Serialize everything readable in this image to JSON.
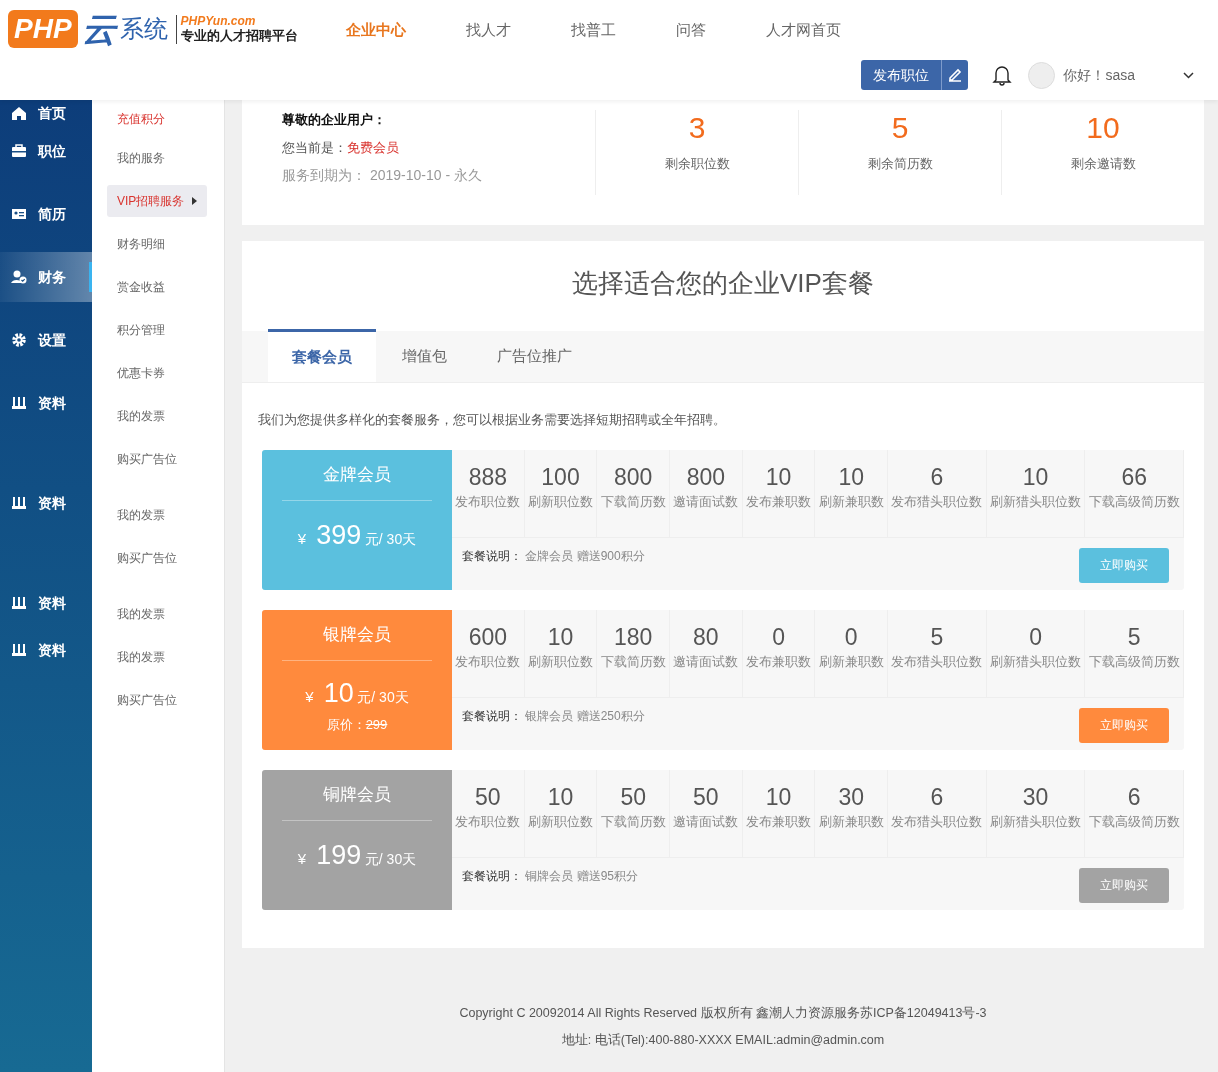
{
  "header": {
    "logo_mark": "PHP",
    "logo_cloud": "云",
    "logo_system": "系统",
    "logo_domain": "PHPYun.com",
    "logo_tagline": "专业的人才招聘平台",
    "nav": [
      {
        "label": "企业中心",
        "selected": true
      },
      {
        "label": "找人才",
        "selected": false
      },
      {
        "label": "找普工",
        "selected": false
      },
      {
        "label": "问答",
        "selected": false
      },
      {
        "label": "人才网首页",
        "selected": false
      }
    ],
    "post_button": "发布职位",
    "greeting": "你好！sasa"
  },
  "sidebar": {
    "items": [
      {
        "label": "首页",
        "selected": false
      },
      {
        "label": "职位",
        "selected": false
      },
      {
        "label": "简历",
        "selected": false
      },
      {
        "label": "财务",
        "selected": true
      },
      {
        "label": "设置",
        "selected": false
      },
      {
        "label": "资料",
        "selected": false
      },
      {
        "label": "资料",
        "selected": false
      },
      {
        "label": "资料",
        "selected": false
      },
      {
        "label": "资料",
        "selected": false
      }
    ]
  },
  "submenu": {
    "items": [
      {
        "label": "充值积分",
        "highlighted": true,
        "selected": false
      },
      {
        "label": "我的服务",
        "highlighted": false,
        "selected": false
      },
      {
        "label": "VIP招聘服务",
        "highlighted": false,
        "selected": true
      },
      {
        "label": "财务明细",
        "highlighted": false,
        "selected": false
      },
      {
        "label": "赏金收益",
        "highlighted": false,
        "selected": false
      },
      {
        "label": "积分管理",
        "highlighted": false,
        "selected": false
      },
      {
        "label": "优惠卡券",
        "highlighted": false,
        "selected": false
      },
      {
        "label": "我的发票",
        "highlighted": false,
        "selected": false
      },
      {
        "label": "购买广告位",
        "highlighted": false,
        "selected": false
      },
      {
        "label": "我的发票",
        "highlighted": false,
        "selected": false
      },
      {
        "label": "购买广告位",
        "highlighted": false,
        "selected": false
      },
      {
        "label": "我的发票",
        "highlighted": false,
        "selected": false
      },
      {
        "label": "我的发票",
        "highlighted": false,
        "selected": false
      },
      {
        "label": "购买广告位",
        "highlighted": false,
        "selected": false
      }
    ]
  },
  "account": {
    "heading": "尊敬的企业用户：",
    "level_label": "您当前是：",
    "level": "免费会员",
    "expiry_label": "服务到期为：",
    "expiry": "2019-10-10 - 永久",
    "stats": [
      {
        "value": "3",
        "label": "剩余职位数"
      },
      {
        "value": "5",
        "label": "剩余简历数"
      },
      {
        "value": "10",
        "label": "剩余邀请数"
      }
    ]
  },
  "vip": {
    "title": "选择适合您的企业VIP套餐",
    "tabs": [
      {
        "label": "套餐会员",
        "selected": true
      },
      {
        "label": "增值包",
        "selected": false
      },
      {
        "label": "广告位推广",
        "selected": false
      }
    ],
    "intro": "我们为您提供多样化的套餐服务，您可以根据业务需要选择短期招聘或全年招聘。",
    "packages": [
      {
        "name": "金牌会员",
        "color": "#5bc0de",
        "currency": "¥",
        "price": "399",
        "unit": "元/ 30天",
        "quotas": [
          {
            "value": "888",
            "label": "发布职位数"
          },
          {
            "value": "100",
            "label": "刷新职位数"
          },
          {
            "value": "800",
            "label": "下载简历数"
          },
          {
            "value": "800",
            "label": "邀请面试数"
          },
          {
            "value": "10",
            "label": "发布兼职数"
          },
          {
            "value": "10",
            "label": "刷新兼职数"
          },
          {
            "value": "6",
            "label": "发布猎头职位数"
          },
          {
            "value": "10",
            "label": "刷新猎头职位数"
          },
          {
            "value": "66",
            "label": "下载高级简历数"
          }
        ],
        "note_label": "套餐说明：",
        "note": "金牌会员 赠送900积分",
        "buy": "立即购买"
      },
      {
        "name": "银牌会员",
        "color": "#ff8a3d",
        "currency": "¥",
        "price": "10",
        "unit": "元/ 30天",
        "original_label": "原价：",
        "original_price": "299",
        "quotas": [
          {
            "value": "600",
            "label": "发布职位数"
          },
          {
            "value": "10",
            "label": "刷新职位数"
          },
          {
            "value": "180",
            "label": "下载简历数"
          },
          {
            "value": "80",
            "label": "邀请面试数"
          },
          {
            "value": "0",
            "label": "发布兼职数"
          },
          {
            "value": "0",
            "label": "刷新兼职数"
          },
          {
            "value": "5",
            "label": "发布猎头职位数"
          },
          {
            "value": "0",
            "label": "刷新猎头职位数"
          },
          {
            "value": "5",
            "label": "下载高级简历数"
          }
        ],
        "note_label": "套餐说明：",
        "note": "银牌会员 赠送250积分",
        "buy": "立即购买"
      },
      {
        "name": "铜牌会员",
        "color": "#a3a3a3",
        "currency": "¥",
        "price": "199",
        "unit": "元/ 30天",
        "quotas": [
          {
            "value": "50",
            "label": "发布职位数"
          },
          {
            "value": "10",
            "label": "刷新职位数"
          },
          {
            "value": "50",
            "label": "下载简历数"
          },
          {
            "value": "50",
            "label": "邀请面试数"
          },
          {
            "value": "10",
            "label": "发布兼职数"
          },
          {
            "value": "30",
            "label": "刷新兼职数"
          },
          {
            "value": "6",
            "label": "发布猎头职位数"
          },
          {
            "value": "30",
            "label": "刷新猎头职位数"
          },
          {
            "value": "6",
            "label": "下载高级简历数"
          }
        ],
        "note_label": "套餐说明：",
        "note": "铜牌会员 赠送95积分",
        "buy": "立即购买"
      }
    ]
  },
  "footer": {
    "lines": [
      "Copyright C 20092014 All Rights Reserved 版权所有 鑫潮人力资源服务苏ICP备12049413号-3",
      "地址: 电话(Tel):400-880-XXXX EMAIL:admin@admin.com"
    ]
  }
}
